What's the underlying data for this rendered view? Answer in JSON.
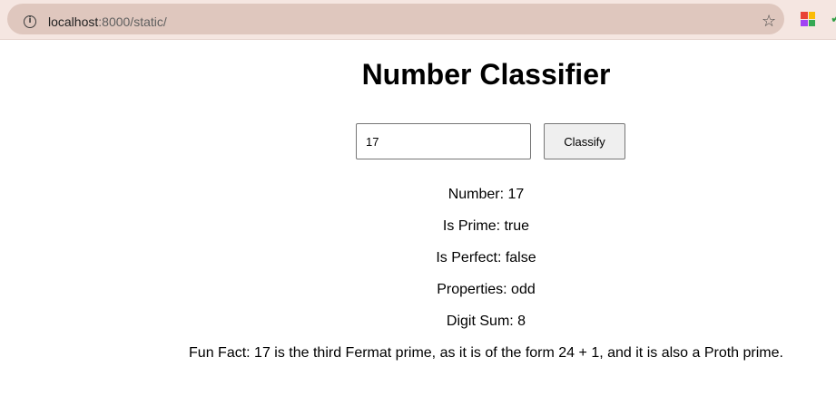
{
  "browser": {
    "url_host": "localhost",
    "url_rest": ":8000/static/"
  },
  "page": {
    "title": "Number Classifier",
    "input_value": "17",
    "button_label": "Classify"
  },
  "results": [
    "Number: 17",
    "Is Prime: true",
    "Is Perfect: false",
    "Properties: odd",
    "Digit Sum: 8",
    "Fun Fact: 17 is the third Fermat prime, as it is of the form 24 + 1, and it is also a Proth prime."
  ]
}
